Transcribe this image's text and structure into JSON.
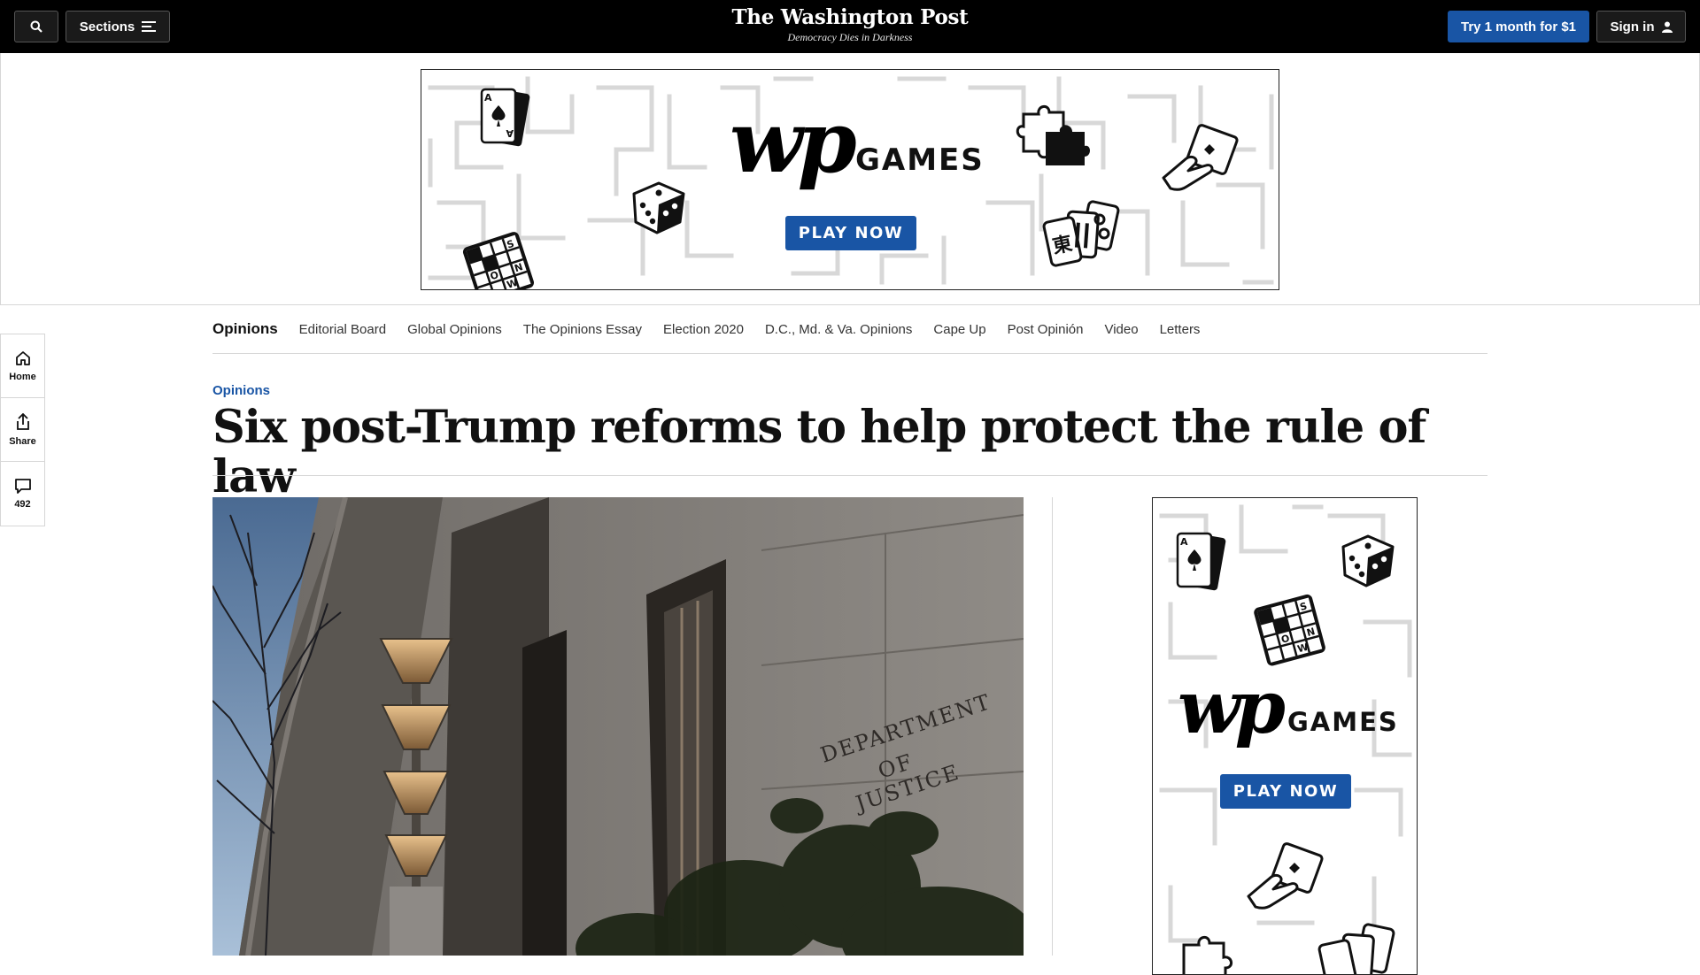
{
  "header": {
    "sections_label": "Sections",
    "masthead_title": "The Washington Post",
    "masthead_tagline": "Democracy Dies in Darkness",
    "subscribe_label": "Try 1 month for $1",
    "signin_label": "Sign in"
  },
  "ads": {
    "games_word": "GAMES",
    "wp_mark": "wp",
    "play_label": "PLAY NOW",
    "mahjong_glyph": "東",
    "crossword_letters": [
      "S",
      "N",
      "O",
      "W"
    ]
  },
  "rail": {
    "items": [
      {
        "label": "Home",
        "icon": "home-icon"
      },
      {
        "label": "Share",
        "icon": "share-icon"
      },
      {
        "label": "492",
        "icon": "comment-icon"
      }
    ]
  },
  "section_nav": {
    "items": [
      "Opinions",
      "Editorial Board",
      "Global Opinions",
      "The Opinions Essay",
      "Election 2020",
      "D.C., Md. & Va. Opinions",
      "Cape Up",
      "Post Opinión",
      "Video",
      "Letters"
    ]
  },
  "article": {
    "kicker": "Opinions",
    "headline": "Six post-Trump reforms to help protect the rule of law",
    "image_sign_lines": [
      "DEPARTMENT",
      "OF",
      "JUSTICE"
    ]
  },
  "colors": {
    "topbar": "#000000",
    "accent_blue": "#1955a5",
    "rule_gray": "#d6d6d6"
  }
}
